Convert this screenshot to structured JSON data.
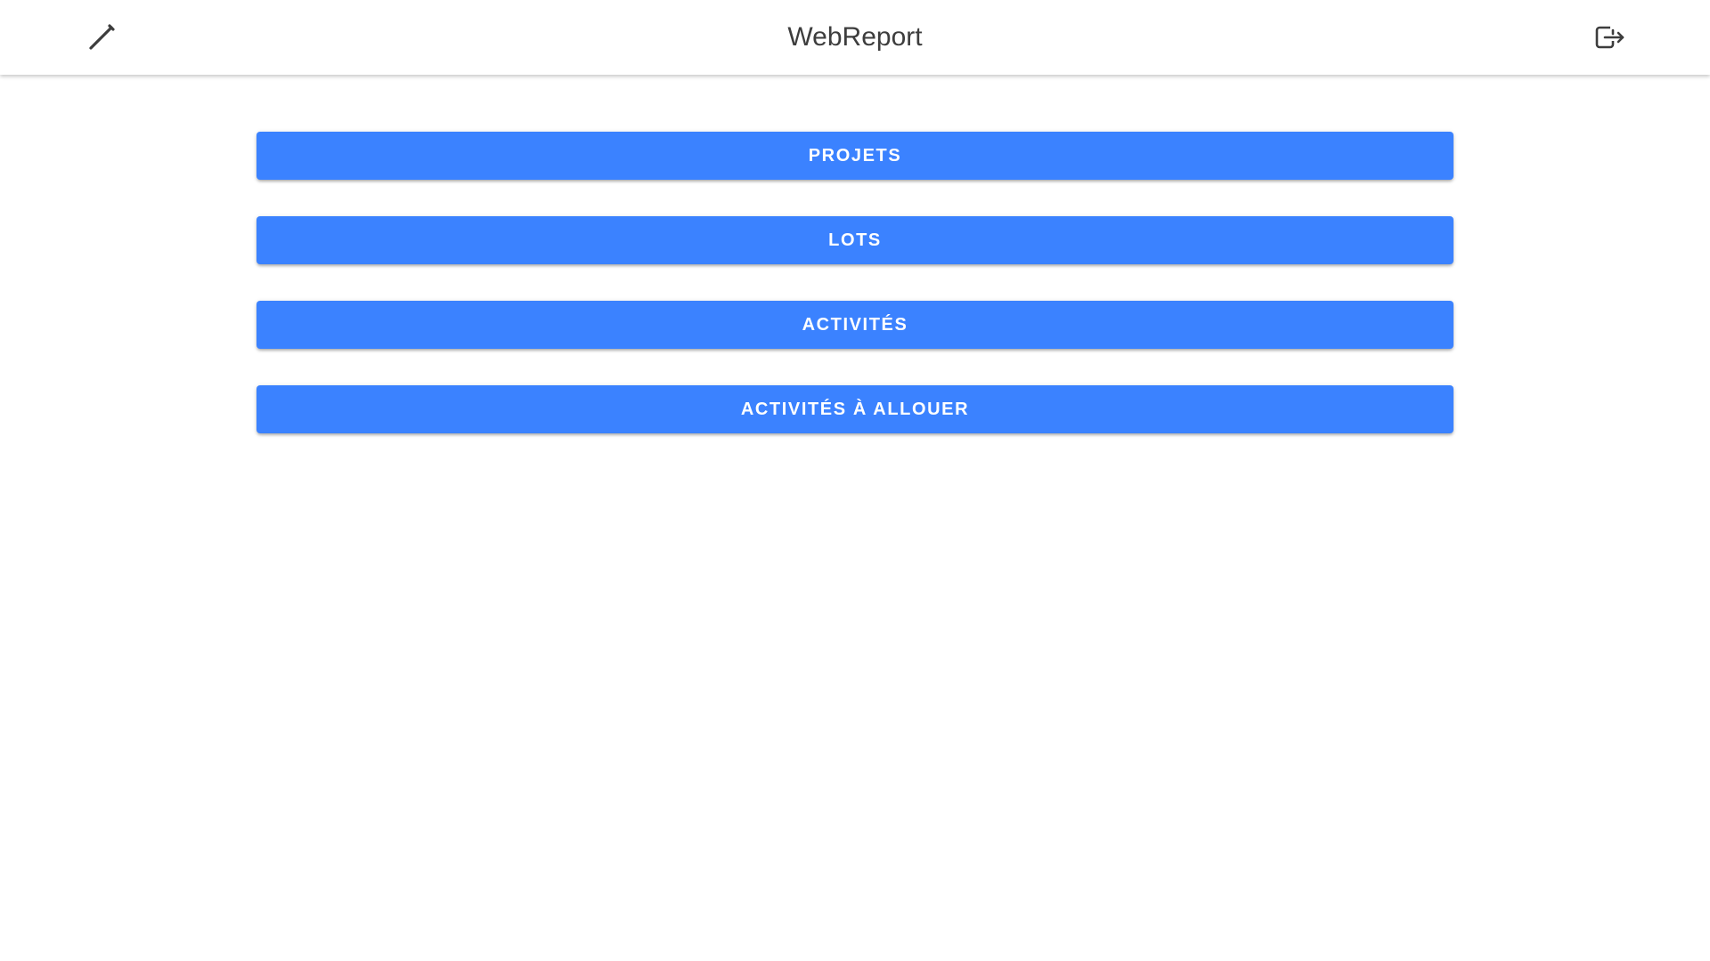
{
  "header": {
    "title": "WebReport",
    "left_icon": "edit-pencil-icon",
    "right_icon": "logout-icon",
    "icon_color": "#3d3d3d"
  },
  "menu": {
    "accent_color": "#3b82ff",
    "buttons": [
      {
        "label": "PROJETS"
      },
      {
        "label": "LOTS"
      },
      {
        "label": "ACTIVITÉS"
      },
      {
        "label": "ACTIVITÉS À ALLOUER"
      }
    ]
  }
}
